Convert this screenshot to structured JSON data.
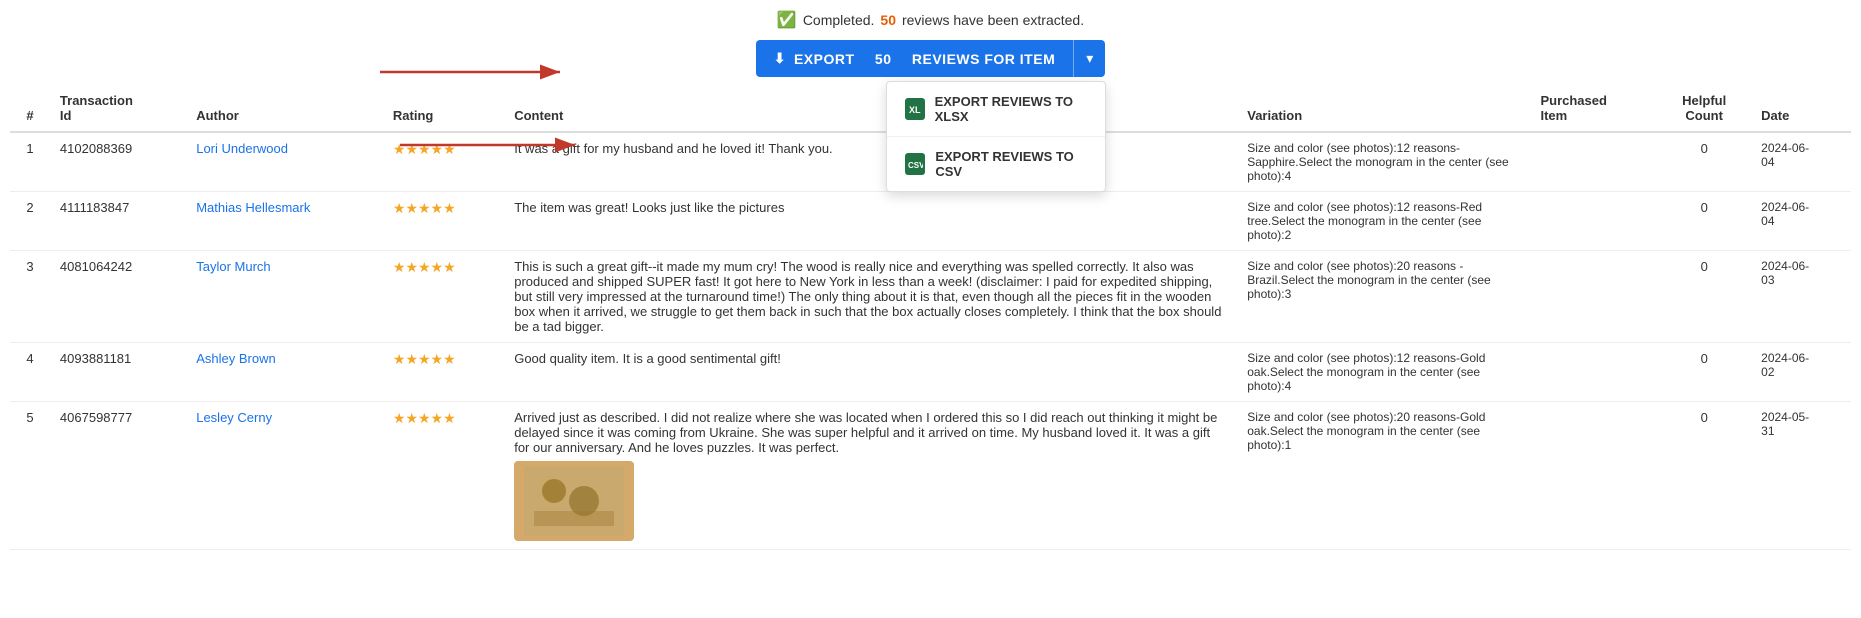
{
  "status": {
    "message_prefix": "Completed.",
    "count": "50",
    "message_suffix": "reviews have been extracted.",
    "check_symbol": "✓"
  },
  "export_button": {
    "label_prefix": "EXPORT",
    "count": "50",
    "label_suffix": "REVIEWS FOR ITEM",
    "download_icon": "⬇",
    "caret": "▾"
  },
  "dropdown": {
    "items": [
      {
        "id": "xlsx",
        "label": "EXPORT REVIEWS TO XLSX",
        "icon_text": "X"
      },
      {
        "id": "csv",
        "label": "EXPORT REVIEWS TO CSV",
        "icon_text": "X"
      }
    ]
  },
  "table": {
    "headers": [
      "#",
      "Transaction Id",
      "Author",
      "Rating",
      "Content",
      "Variation",
      "Purchased Item",
      "Helpful Count",
      "Date"
    ],
    "rows": [
      {
        "num": "1",
        "transaction_id": "4102088369",
        "author": "Lori Underwood",
        "rating": 5,
        "content": "It was a gift for my husband and he loved it! Thank you.",
        "variation": "Size and color (see photos):12 reasons-Sapphire.Select the monogram in the center (see photo):4",
        "purchased_item": "",
        "helpful_count": "0",
        "date": "2024-06-04",
        "has_image": false
      },
      {
        "num": "2",
        "transaction_id": "4111183847",
        "author": "Mathias Hellesmark",
        "rating": 5,
        "content": "The item was great! Looks just like the pictures",
        "variation": "Size and color (see photos):12 reasons-Red tree.Select the monogram in the center (see photo):2",
        "purchased_item": "",
        "helpful_count": "0",
        "date": "2024-06-04",
        "has_image": false
      },
      {
        "num": "3",
        "transaction_id": "4081064242",
        "author": "Taylor Murch",
        "rating": 5,
        "content": "This is such a great gift--it made my mum cry! The wood is really nice and everything was spelled correctly. It also was produced and shipped SUPER fast! It got here to New York in less than a week! (disclaimer: I paid for expedited shipping, but still very impressed at the turnaround time!) The only thing about it is that, even though all the pieces fit in the wooden box when it arrived, we struggle to get them back in such that the box actually closes completely. I think that the box should be a tad bigger.",
        "variation": "Size and color (see photos):20 reasons - Brazil.Select the monogram in the center (see photo):3",
        "purchased_item": "",
        "helpful_count": "0",
        "date": "2024-06-03",
        "has_image": false
      },
      {
        "num": "4",
        "transaction_id": "4093881181",
        "author": "Ashley Brown",
        "rating": 5,
        "content": "Good quality item. It is a good sentimental gift!",
        "variation": "Size and color (see photos):12 reasons-Gold oak.Select the monogram in the center (see photo):4",
        "purchased_item": "",
        "helpful_count": "0",
        "date": "2024-06-02",
        "has_image": false
      },
      {
        "num": "5",
        "transaction_id": "4067598777",
        "author": "Lesley Cerny",
        "rating": 5,
        "content": "Arrived just as described. I did not realize where she was located when I ordered this so I did reach out thinking it might be delayed since it was coming from Ukraine. She was super helpful and it arrived on time. My husband loved it. It was a gift for our anniversary. And he loves puzzles. It was perfect.",
        "variation": "Size and color (see photos):20 reasons-Gold oak.Select the monogram in the center (see photo):1",
        "purchased_item": "",
        "helpful_count": "0",
        "date": "2024-05-31",
        "has_image": true
      }
    ]
  }
}
